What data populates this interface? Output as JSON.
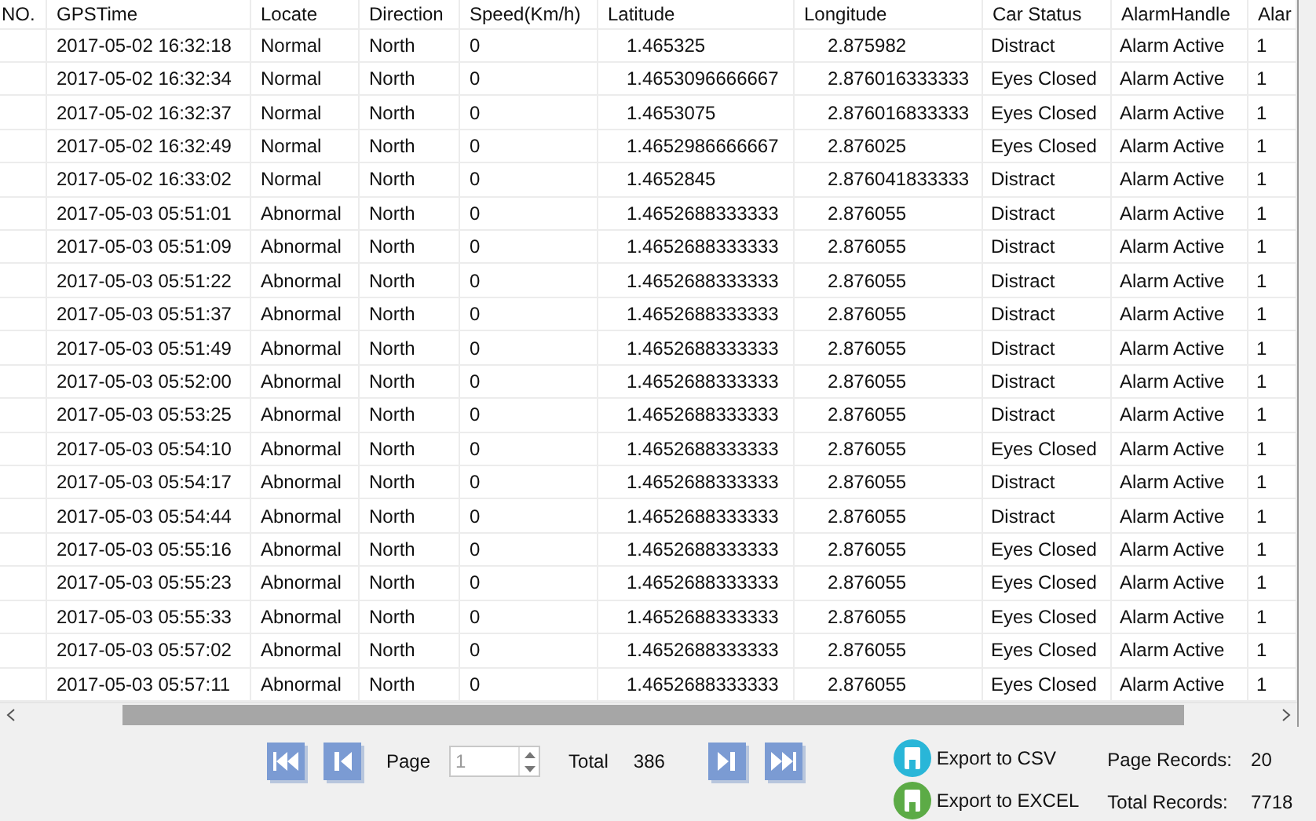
{
  "table": {
    "columns": [
      "NO.",
      "GPSTime",
      "Locate",
      "Direction",
      "Speed(Km/h)",
      "Latitude",
      "Longitude",
      "Car Status",
      "AlarmHandle",
      "Alar"
    ],
    "rows": [
      {
        "cells": [
          "",
          "2017-05-02 16:32:18",
          "Normal",
          "North",
          "0",
          "1.465325",
          "2.875982",
          "Distract",
          "Alarm Active",
          "1"
        ]
      },
      {
        "cells": [
          "",
          "2017-05-02 16:32:34",
          "Normal",
          "North",
          "0",
          "1.4653096666667",
          "2.876016333333",
          "Eyes Closed",
          "Alarm Active",
          "1"
        ]
      },
      {
        "cells": [
          "",
          "2017-05-02 16:32:37",
          "Normal",
          "North",
          "0",
          "1.4653075",
          "2.876016833333",
          "Eyes Closed",
          "Alarm Active",
          "1"
        ]
      },
      {
        "cells": [
          "",
          "2017-05-02 16:32:49",
          "Normal",
          "North",
          "0",
          "1.4652986666667",
          "2.876025",
          "Eyes Closed",
          "Alarm Active",
          "1"
        ]
      },
      {
        "cells": [
          "",
          "2017-05-02 16:33:02",
          "Normal",
          "North",
          "0",
          "1.4652845",
          "2.876041833333",
          "Distract",
          "Alarm Active",
          "1"
        ]
      },
      {
        "cells": [
          "",
          "2017-05-03 05:51:01",
          "Abnormal",
          "North",
          "0",
          "1.4652688333333",
          "2.876055",
          "Distract",
          "Alarm Active",
          "1"
        ]
      },
      {
        "cells": [
          "",
          "2017-05-03 05:51:09",
          "Abnormal",
          "North",
          "0",
          "1.4652688333333",
          "2.876055",
          "Distract",
          "Alarm Active",
          "1"
        ]
      },
      {
        "cells": [
          "",
          "2017-05-03 05:51:22",
          "Abnormal",
          "North",
          "0",
          "1.4652688333333",
          "2.876055",
          "Distract",
          "Alarm Active",
          "1"
        ]
      },
      {
        "cells": [
          "",
          "2017-05-03 05:51:37",
          "Abnormal",
          "North",
          "0",
          "1.4652688333333",
          "2.876055",
          "Distract",
          "Alarm Active",
          "1"
        ]
      },
      {
        "cells": [
          "",
          "2017-05-03 05:51:49",
          "Abnormal",
          "North",
          "0",
          "1.4652688333333",
          "2.876055",
          "Distract",
          "Alarm Active",
          "1"
        ]
      },
      {
        "cells": [
          "",
          "2017-05-03 05:52:00",
          "Abnormal",
          "North",
          "0",
          "1.4652688333333",
          "2.876055",
          "Distract",
          "Alarm Active",
          "1"
        ]
      },
      {
        "cells": [
          "",
          "2017-05-03 05:53:25",
          "Abnormal",
          "North",
          "0",
          "1.4652688333333",
          "2.876055",
          "Distract",
          "Alarm Active",
          "1"
        ]
      },
      {
        "cells": [
          "",
          "2017-05-03 05:54:10",
          "Abnormal",
          "North",
          "0",
          "1.4652688333333",
          "2.876055",
          "Eyes Closed",
          "Alarm Active",
          "1"
        ]
      },
      {
        "cells": [
          "",
          "2017-05-03 05:54:17",
          "Abnormal",
          "North",
          "0",
          "1.4652688333333",
          "2.876055",
          "Distract",
          "Alarm Active",
          "1"
        ]
      },
      {
        "cells": [
          "",
          "2017-05-03 05:54:44",
          "Abnormal",
          "North",
          "0",
          "1.4652688333333",
          "2.876055",
          "Distract",
          "Alarm Active",
          "1"
        ]
      },
      {
        "cells": [
          "",
          "2017-05-03 05:55:16",
          "Abnormal",
          "North",
          "0",
          "1.4652688333333",
          "2.876055",
          "Eyes Closed",
          "Alarm Active",
          "1"
        ]
      },
      {
        "cells": [
          "",
          "2017-05-03 05:55:23",
          "Abnormal",
          "North",
          "0",
          "1.4652688333333",
          "2.876055",
          "Eyes Closed",
          "Alarm Active",
          "1"
        ]
      },
      {
        "cells": [
          "",
          "2017-05-03 05:55:33",
          "Abnormal",
          "North",
          "0",
          "1.4652688333333",
          "2.876055",
          "Eyes Closed",
          "Alarm Active",
          "1"
        ]
      },
      {
        "cells": [
          "",
          "2017-05-03 05:57:02",
          "Abnormal",
          "North",
          "0",
          "1.4652688333333",
          "2.876055",
          "Eyes Closed",
          "Alarm Active",
          "1"
        ]
      },
      {
        "cells": [
          "",
          "2017-05-03 05:57:11",
          "Abnormal",
          "North",
          "0",
          "1.4652688333333",
          "2.876055",
          "Eyes Closed",
          "Alarm Active",
          "1"
        ]
      }
    ]
  },
  "pager": {
    "page_label": "Page",
    "page_value": "1",
    "total_label": "Total",
    "total_value": "386"
  },
  "exports": [
    {
      "label": "Export to CSV",
      "color": "#29b6d8"
    },
    {
      "label": "Export to EXCEL",
      "color": "#5cab46"
    }
  ],
  "records": [
    {
      "label": "Page Records:",
      "value": "20"
    },
    {
      "label": "Total Records:",
      "value": "7718"
    }
  ]
}
